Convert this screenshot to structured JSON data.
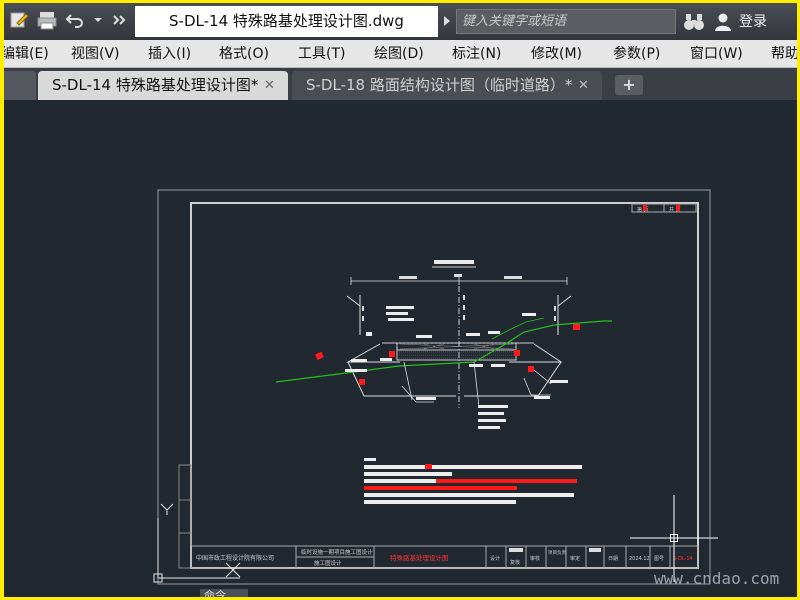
{
  "title_bar": {
    "document_title": "S-DL-14 特殊路基处理设计图.dwg",
    "search_placeholder": "键入关键字或短语",
    "login_label": "登录",
    "quick_access": [
      "document-icon",
      "plotter-icon",
      "undo-icon",
      "dropdown-icon",
      "more-icon"
    ]
  },
  "menu": {
    "items": [
      "编辑(E)",
      "视图(V)",
      "插入(I)",
      "格式(O)",
      "工具(T)",
      "绘图(D)",
      "标注(N)",
      "修改(M)",
      "参数(P)",
      "窗口(W)",
      "帮助"
    ]
  },
  "tabs": [
    {
      "label": "S-DL-14 特殊路基处理设计图*",
      "active": true
    },
    {
      "label": "S-DL-18 路面结构设计图（临时道路）*",
      "active": false
    }
  ],
  "tab_close_glyph": "✕",
  "tab_add_glyph": "+",
  "drawing": {
    "title_block": {
      "company": "中国市政工程设计院有限公司",
      "project": "临时设施一期项目施工图设计",
      "project_sub": "施工图设计",
      "drawing_title": "特殊路基处理设计图",
      "design_label": "设计",
      "check_label": "复核",
      "review_label": "审核",
      "chief_label": "项目负责",
      "approve_label": "审定",
      "date_label": "日期",
      "date_value": "2024.12",
      "number_label": "图号",
      "number_value": "S-DL-14",
      "sheet_label": "第  页",
      "total_label": "共  页"
    }
  },
  "command_label": "命令",
  "ucs": {
    "y_label": "Y"
  },
  "watermark": "www.cndao.com",
  "colors": {
    "frame": "#c8c8c8",
    "ground_line": "#21c01c",
    "highlight": "#ff1a1a",
    "canvas": "#212830"
  }
}
